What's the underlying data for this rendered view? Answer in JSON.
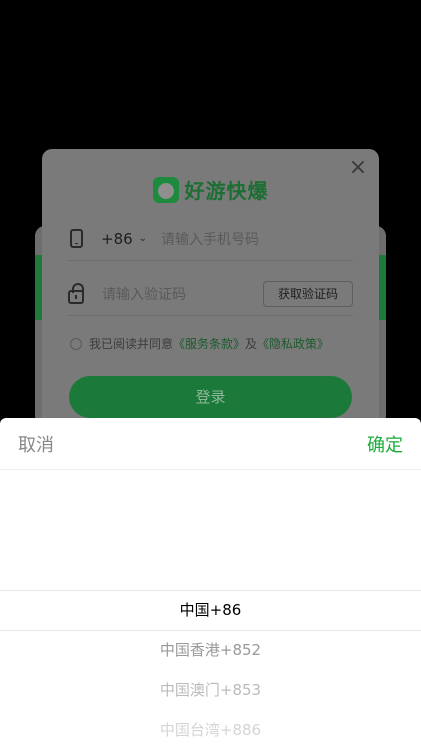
{
  "login": {
    "logo_text": "好游快爆",
    "close_symbol": "×",
    "country_code": "+86",
    "chevron": "⌄",
    "phone_placeholder": "请输入手机号码",
    "code_placeholder": "请输入验证码",
    "get_code_label": "获取验证码",
    "agree_prefix": "我已阅读并同意",
    "terms_link": "《服务条款》",
    "agree_and": "及",
    "privacy_link": "《隐私政策》",
    "login_label": "登录"
  },
  "picker": {
    "cancel_label": "取消",
    "confirm_label": "确定",
    "options": [
      {
        "label": "中国+86",
        "selected": true
      },
      {
        "label": "中国香港+852",
        "selected": false
      },
      {
        "label": "中国澳门+853",
        "selected": false
      },
      {
        "label": "中国台湾+886",
        "selected": false
      }
    ]
  },
  "colors": {
    "accent_green": "#1aad3a",
    "overlay": "#000000"
  }
}
